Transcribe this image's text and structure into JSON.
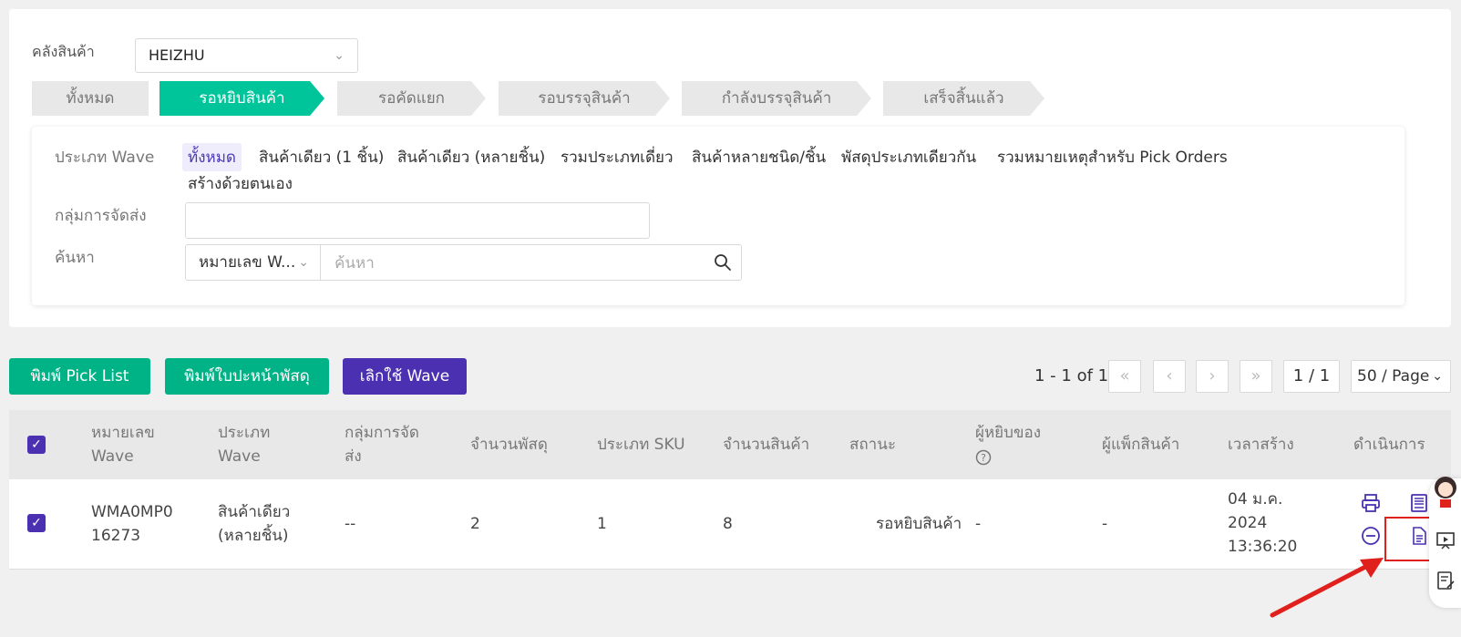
{
  "filters": {
    "warehouse_label": "คลังสินค้า",
    "warehouse_value": "HEIZHU",
    "wave_type_label": "ประเภท Wave",
    "shipping_group_label": "กลุ่มการจัดส่ง",
    "search_label": "ค้นหา",
    "search_type": "หมายเลข W...",
    "search_placeholder": "ค้นหา"
  },
  "steps": [
    {
      "label": "ทั้งหมด",
      "active": false
    },
    {
      "label": "รอหยิบสินค้า",
      "active": true
    },
    {
      "label": "รอคัดแยก",
      "active": false
    },
    {
      "label": "รอบรรจุสินค้า",
      "active": false
    },
    {
      "label": "กำลังบรรจุสินค้า",
      "active": false
    },
    {
      "label": "เสร็จสิ้นแล้ว",
      "active": false
    }
  ],
  "wave_types": [
    {
      "label": "ทั้งหมด",
      "active": true
    },
    {
      "label": "สินค้าเดียว (1 ชิ้น)"
    },
    {
      "label": "สินค้าเดียว (หลายชิ้น)"
    },
    {
      "label": "รวมประเภทเดี่ยว"
    },
    {
      "label": "สินค้าหลายชนิด/ชิ้น"
    },
    {
      "label": "พัสดุประเภทเดียวกัน"
    },
    {
      "label": "รวมหมายเหตุสำหรับ Pick Orders"
    },
    {
      "label": "สร้างด้วยตนเอง"
    }
  ],
  "actions": {
    "print_pick_list": "พิมพ์ Pick List",
    "print_labels": "พิมพ์ใบปะหน้าพัสดุ",
    "cancel_wave": "เลิกใช้ Wave"
  },
  "pagination": {
    "range": "1 - 1 of 1",
    "first": "«",
    "prev": "‹",
    "next": "›",
    "last": "»",
    "page": "1 / 1",
    "page_size": "50 / Page"
  },
  "table": {
    "headers": {
      "wave_no": "หมายเลข Wave",
      "type": "ประเภท Wave",
      "group": "กลุ่มการจัดส่ง",
      "parcels": "จำนวนพัสดุ",
      "sku_type": "ประเภท SKU",
      "qty": "จำนวนสินค้า",
      "status": "สถานะ",
      "picker": "ผู้หยิบของ",
      "packer": "ผู้แพ็กสินค้า",
      "created": "เวลาสร้าง",
      "actions": "ดำเนินการ"
    },
    "rows": [
      {
        "wave_no": "WMA0MP0 16273",
        "type": "สินค้าเดียว (หลายชิ้น)",
        "group": "--",
        "parcels": "2",
        "sku_type": "1",
        "qty": "8",
        "status": "รอหยิบสินค้า",
        "picker": "-",
        "packer": "-",
        "created_date": "04 ม.ค. 2024",
        "created_time": "13:36:20"
      }
    ]
  },
  "icons": {
    "search": "search-icon",
    "print": "printer-icon",
    "cancel": "minus-circle-icon",
    "pick_list": "pick-list-icon",
    "document": "document-icon",
    "help": "question-circle-icon"
  },
  "colors": {
    "accent_green": "#00c49a",
    "button_green": "#00b386",
    "purple": "#4b31b1",
    "highlight_red": "#e0201c"
  }
}
